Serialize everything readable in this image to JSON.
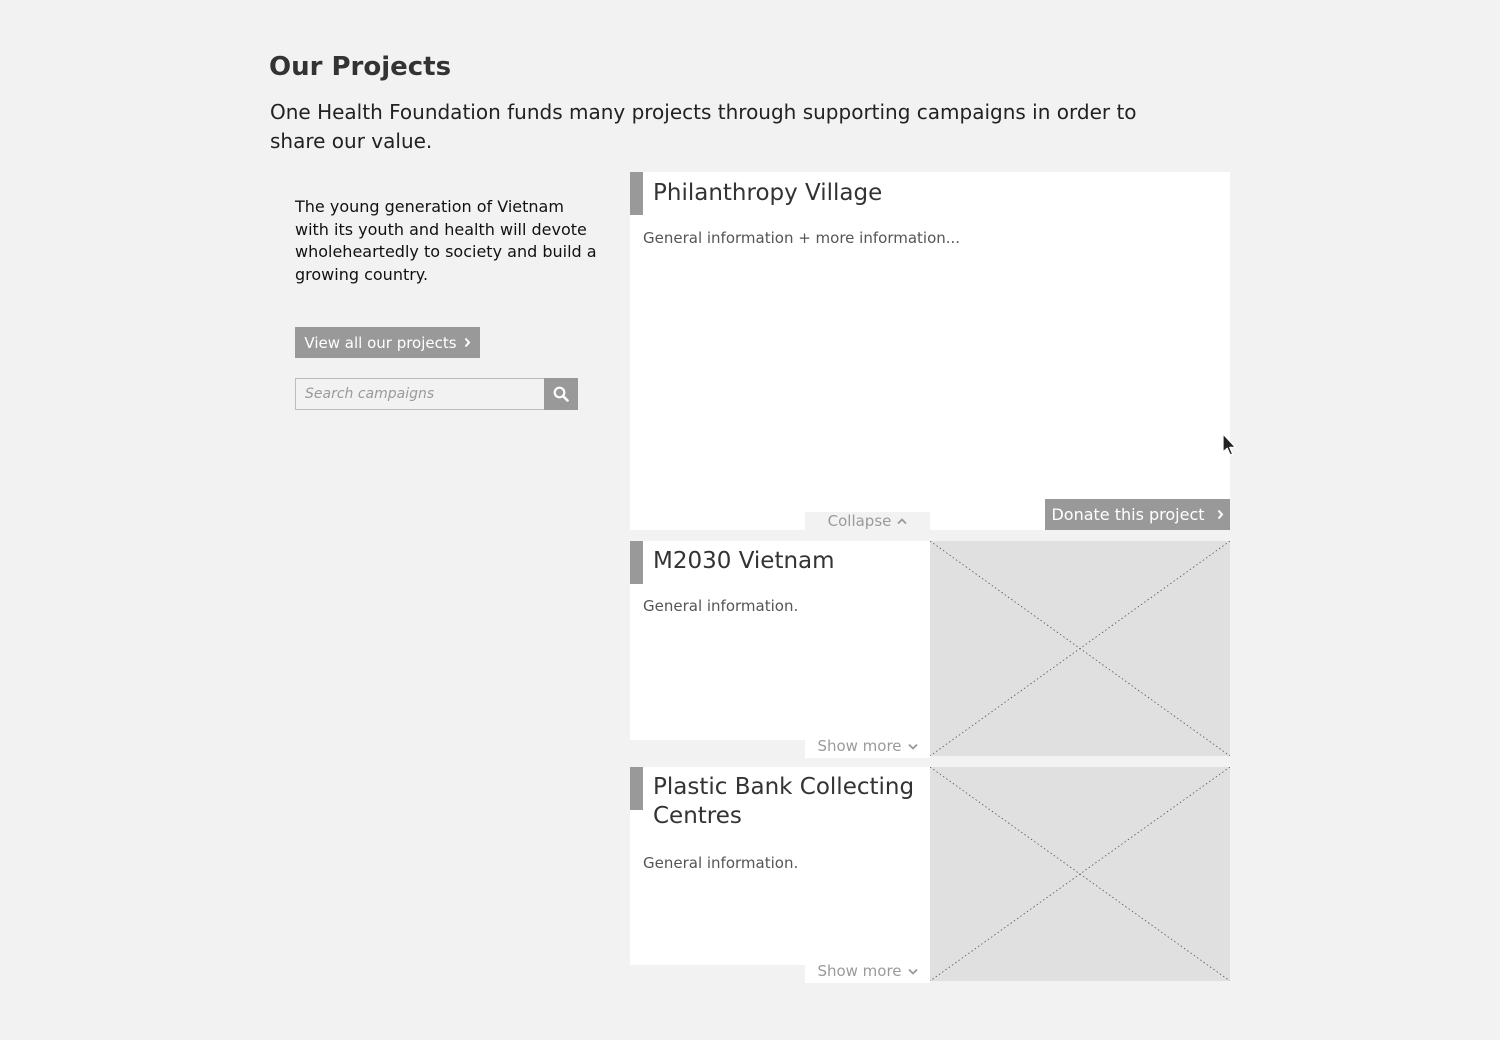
{
  "header": {
    "title": "Our Projects",
    "intro": "One Health Foundation funds many projects through supporting campaigns in order to share our value."
  },
  "sidebar": {
    "description": "The young generation of Vietnam with its youth and health will devote wholeheartedly to society and build a growing country.",
    "view_all_label": "View all our projects",
    "search": {
      "placeholder": "Search campaigns",
      "value": ""
    }
  },
  "projects": [
    {
      "title": "Philanthropy Village",
      "description": "General information + more information...",
      "toggle_label": "Collapse",
      "donate_label": "Donate this project",
      "expanded": true
    },
    {
      "title": "M2030 Vietnam",
      "description": "General information.",
      "toggle_label": "Show more",
      "expanded": false
    },
    {
      "title": "Plastic Bank Collecting Centres",
      "description": "General information.",
      "toggle_label": "Show more",
      "expanded": false
    }
  ],
  "icons": [
    "chevron-right-icon",
    "search-icon",
    "chevron-up-icon",
    "chevron-down-icon",
    "image-placeholder-icon",
    "mouse-cursor-icon"
  ],
  "colors": {
    "background": "#f2f2f2",
    "button": "#999999",
    "card": "#ffffff",
    "image_placeholder": "#e0e0e0",
    "text": "#333333"
  }
}
